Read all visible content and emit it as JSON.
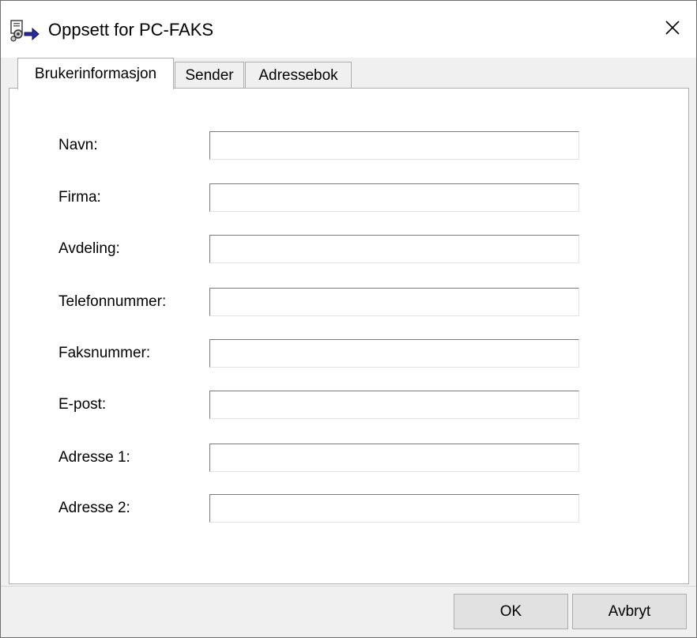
{
  "window": {
    "title": "Oppsett for PC-FAKS",
    "icon": "fax-setup-icon",
    "close_glyph": "✕"
  },
  "tabs": [
    {
      "label": "Brukerinformasjon",
      "active": true
    },
    {
      "label": "Sender",
      "active": false
    },
    {
      "label": "Adressebok",
      "active": false
    }
  ],
  "form": {
    "fields": [
      {
        "label": "Navn:",
        "value": ""
      },
      {
        "label": "Firma:",
        "value": ""
      },
      {
        "label": "Avdeling:",
        "value": ""
      },
      {
        "label": "Telefonnummer:",
        "value": ""
      },
      {
        "label": "Faksnummer:",
        "value": ""
      },
      {
        "label": "E-post:",
        "value": ""
      },
      {
        "label": "Adresse 1:",
        "value": ""
      },
      {
        "label": "Adresse 2:",
        "value": ""
      }
    ]
  },
  "buttons": {
    "ok_label": "OK",
    "cancel_label": "Avbryt"
  },
  "colors": {
    "window_bg": "#f0f0f0",
    "panel_bg": "#ffffff",
    "border": "#adadad",
    "button_bg": "#e1e1e1"
  }
}
